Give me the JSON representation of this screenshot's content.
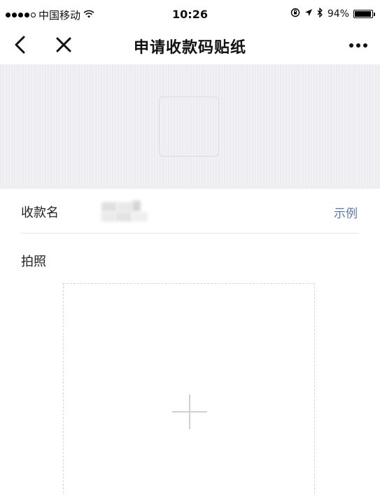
{
  "status_bar": {
    "carrier": "中国移动",
    "time": "10:26",
    "battery": "94%",
    "battery_level": 0.94
  },
  "nav": {
    "title": "申请收款码贴纸"
  },
  "form": {
    "name_label": "收款名",
    "example_link": "示例",
    "photo_label": "拍照"
  }
}
